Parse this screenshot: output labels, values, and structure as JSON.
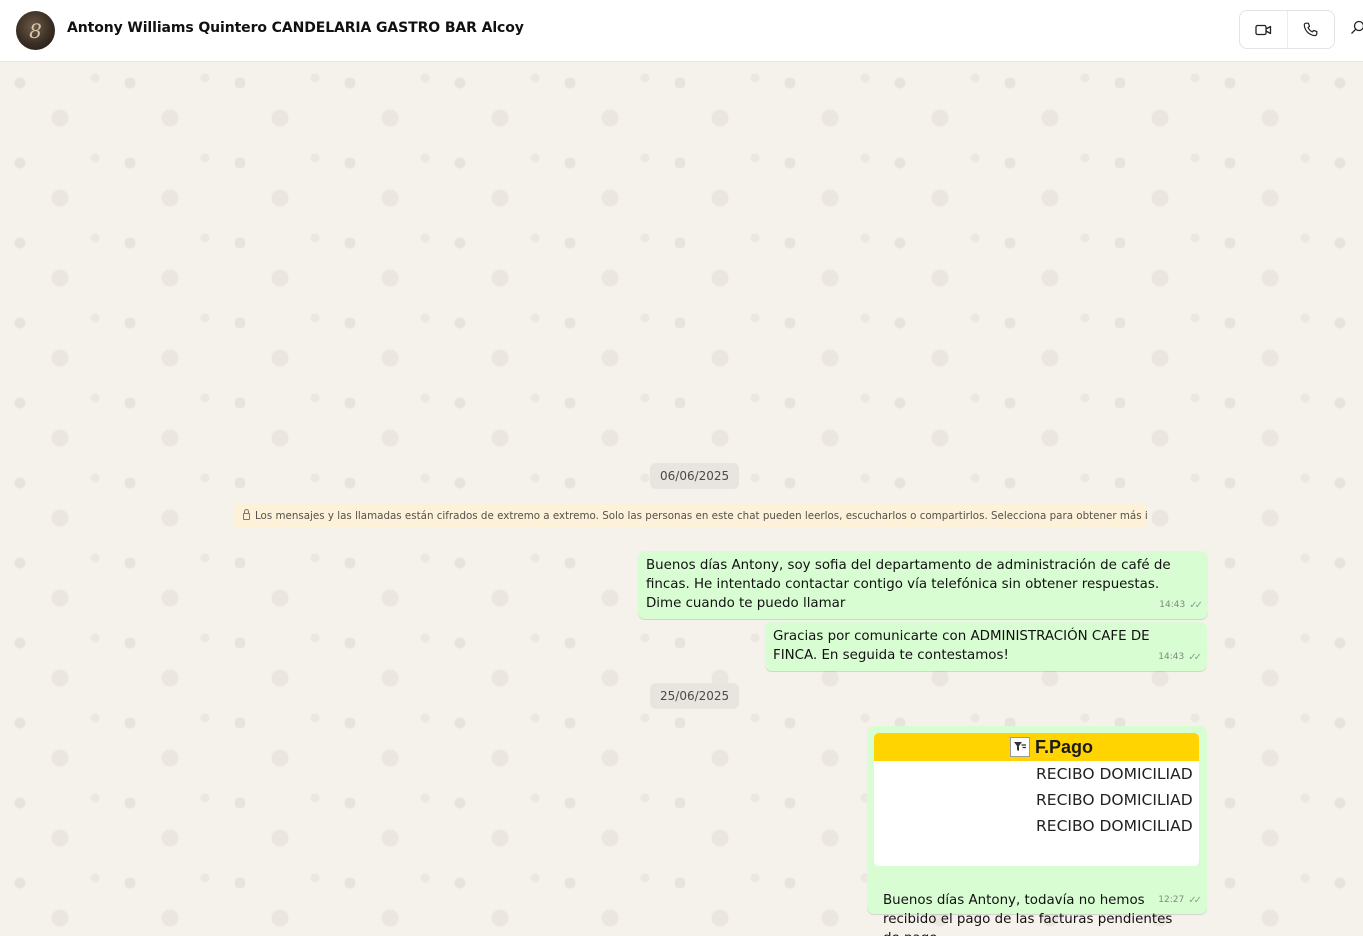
{
  "header": {
    "title": "Antony Williams Quintero CANDELARIA GASTRO BAR Alcoy",
    "avatar_glyph": "8",
    "icons": [
      "video-call-icon",
      "voice-call-icon",
      "search-icon"
    ]
  },
  "chat": {
    "date_1": "06/06/2025",
    "notice": "Los mensajes y las llamadas están cifrados de extremo a extremo. Solo las personas en este chat pueden leerlos, escucharlos o compartirlos. Selecciona para obtener más información.",
    "msg_1": {
      "text": "Buenos días Antony, soy sofia del departamento de administración de café de fincas. He intentado contactar contigo vía telefónica sin obtener respuestas. Dime cuando te puedo llamar",
      "time": "14:43"
    },
    "msg_2": {
      "text": "Gracias por comunicarte con ADMINISTRACIÓN CAFE DE FINCA. En seguida te contestamos!",
      "time": "14:43"
    },
    "date_2": "25/06/2025",
    "msg_3": {
      "image": {
        "header": "F.Pago",
        "rows": [
          "RECIBO DOMICILIAD",
          "RECIBO DOMICILIAD",
          "RECIBO DOMICILIAD"
        ]
      },
      "text": "Buenos días Antony, todavía no hemos recibido el pago de las facturas pendientes de pago.",
      "time": "12:27"
    }
  },
  "colors": {
    "outgoing_bubble": "#d9fdd3",
    "wallpaper": "#f5f1eb",
    "notice_bg": "#fdf1d9",
    "image_header": "#ffd400"
  }
}
